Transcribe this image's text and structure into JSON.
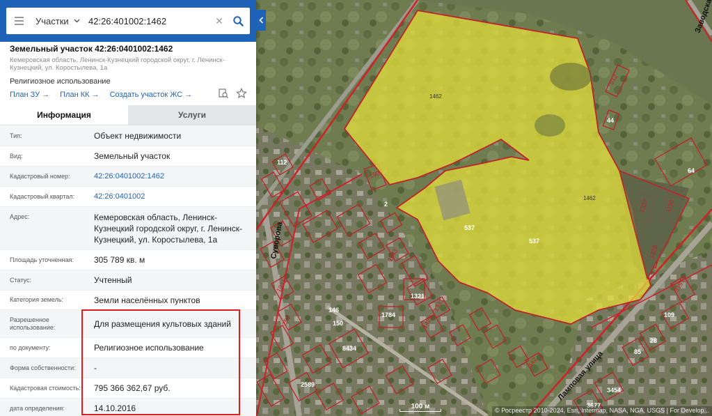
{
  "search": {
    "type_label": "Участки",
    "query": "42:26:401002:1462",
    "clear_glyph": "✕"
  },
  "header": {
    "title": "Земельный участок 42:26:0401002:1462",
    "address": "Кемеровская область, Ленинск-Кузнецкий городской округ, г. Ленинск-Кузнецкий, ул. Коростылева, 1а",
    "use": "Религиозное использование",
    "links": [
      "План ЗУ →",
      "План КК →",
      "Создать участок ЖС →"
    ]
  },
  "tabs": {
    "info": "Информация",
    "services": "Услуги"
  },
  "rows": [
    {
      "label": "Тип:",
      "value": "Объект недвижимости"
    },
    {
      "label": "Вид:",
      "value": "Земельный участок"
    },
    {
      "label": "Кадастровый номер:",
      "value": "42:26:0401002:1462"
    },
    {
      "label": "Кадастровый квартал:",
      "value": "42:26:0401002"
    },
    {
      "label": "Адрес:",
      "value": "Кемеровская область, Ленинск-Кузнецкий городской округ, г. Ленинск-Кузнецкий, ул. Коростылева, 1а"
    },
    {
      "label": "Площадь уточненная:",
      "value": "305 789 кв. м"
    },
    {
      "label": "Статус:",
      "value": "Учтенный"
    },
    {
      "label": "Категория земель:",
      "value": "Земли населённых пунктов"
    },
    {
      "label": "Разрешенное использование:",
      "value": "Для размещения культовых зданий"
    },
    {
      "label": "по документу:",
      "value": "Религиозное использование"
    },
    {
      "label": "Форма собственности:",
      "value": "-"
    },
    {
      "label": "Кадастровая стоимость:",
      "value": "795 366 362,67 руб."
    },
    {
      "label": "дата определения:",
      "value": "14.10.2016"
    }
  ],
  "map": {
    "parcel_label": "1462",
    "parcel_label_2": "1462",
    "streets": [
      "Суворова",
      "Ламповая улица",
      "Заводская"
    ],
    "plot_numbers": [
      "512",
      "44",
      "64",
      "1130",
      "1327",
      "1329",
      "537",
      "537",
      "2",
      "190",
      "1321",
      "1784",
      "8434",
      "1420",
      "1331",
      "1143",
      "3197",
      "109",
      "28",
      "85",
      "442",
      "3454",
      "3677",
      "2589",
      "250",
      "1931",
      "112",
      "146",
      "150"
    ],
    "scale_label": "100 м",
    "attribution": "© Росреестр 2010-2024, Esri, Intermap, NASA, NGA, USGS | For Develop...",
    "colors": {
      "parcel_fill": "#e8e23a",
      "parcel_stroke": "#c0222a",
      "boundary": "#d0202a"
    }
  }
}
